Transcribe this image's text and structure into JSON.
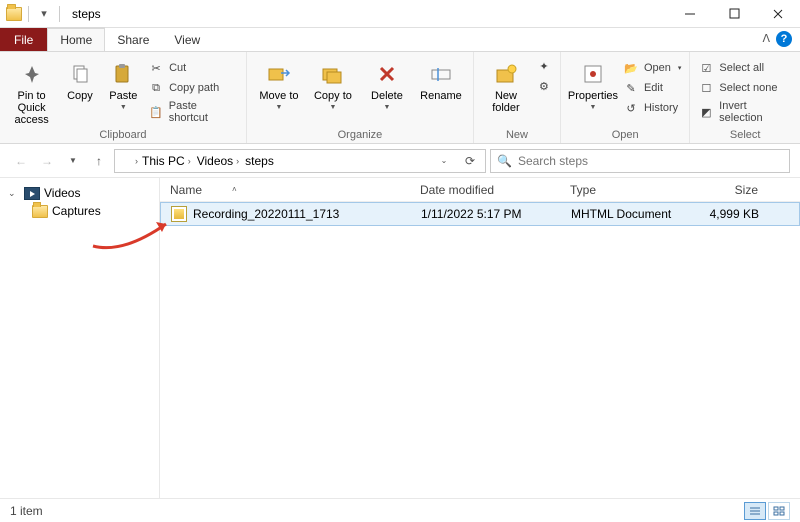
{
  "title": "steps",
  "tabs": {
    "file": "File",
    "home": "Home",
    "share": "Share",
    "view": "View"
  },
  "ribbon": {
    "clipboard": {
      "label": "Clipboard",
      "pin": "Pin to Quick access",
      "copy": "Copy",
      "paste": "Paste",
      "cut": "Cut",
      "copypath": "Copy path",
      "shortcut": "Paste shortcut"
    },
    "organize": {
      "label": "Organize",
      "moveto": "Move to",
      "copyto": "Copy to",
      "delete": "Delete",
      "rename": "Rename"
    },
    "new": {
      "label": "New",
      "newfolder": "New folder"
    },
    "open": {
      "label": "Open",
      "properties": "Properties",
      "open": "Open",
      "edit": "Edit",
      "history": "History"
    },
    "select": {
      "label": "Select",
      "all": "Select all",
      "none": "Select none",
      "invert": "Invert selection"
    }
  },
  "breadcrumb": {
    "p0": "This PC",
    "p1": "Videos",
    "p2": "steps"
  },
  "search": {
    "placeholder": "Search steps"
  },
  "tree": {
    "videos": "Videos",
    "captures": "Captures"
  },
  "columns": {
    "name": "Name",
    "date": "Date modified",
    "type": "Type",
    "size": "Size"
  },
  "rows": [
    {
      "name": "Recording_20220111_1713",
      "date": "1/11/2022 5:17 PM",
      "type": "MHTML Document",
      "size": "4,999 KB"
    }
  ],
  "status": {
    "count": "1 item"
  }
}
